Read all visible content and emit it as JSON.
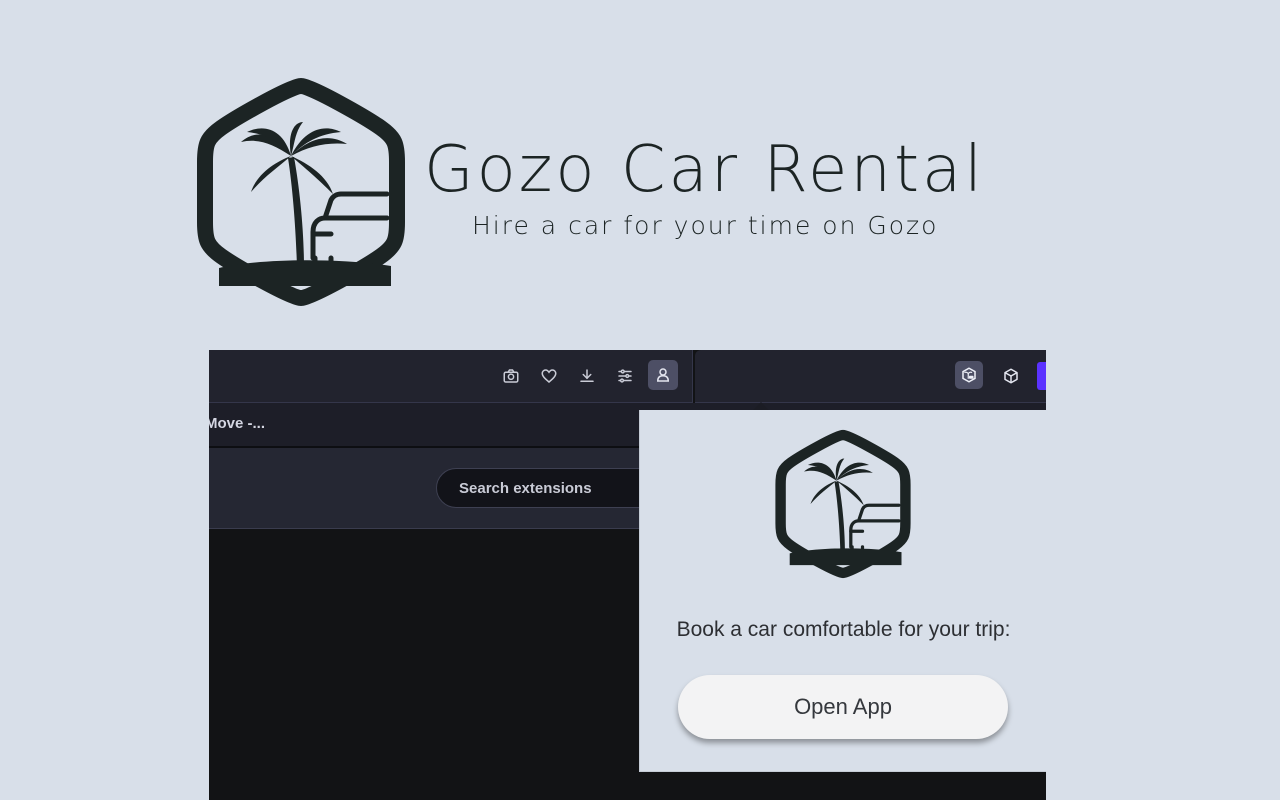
{
  "brand": {
    "title": "Gozo Car Rental",
    "tagline": "Hire a car for your time on Gozo",
    "logo_icon": "palm-tree-car-hexagon-logo"
  },
  "browser": {
    "toolbar_icons": [
      "camera-icon",
      "heart-icon",
      "download-icon",
      "sliders-icon",
      "profile-icon"
    ],
    "extension_icons": [
      "gozo-extension-icon",
      "cube-icon"
    ],
    "tab_label": "Move -...",
    "search_placeholder": "Search extensions"
  },
  "popup": {
    "prompt": "Book a car comfortable for your trip:",
    "button_label": "Open App"
  },
  "colors": {
    "background": "#d8dfe9",
    "logo_dark": "#1c2424",
    "toolbar": "#22232e",
    "accent_purple": "#5b32ff",
    "button": "#f3f3f4"
  }
}
